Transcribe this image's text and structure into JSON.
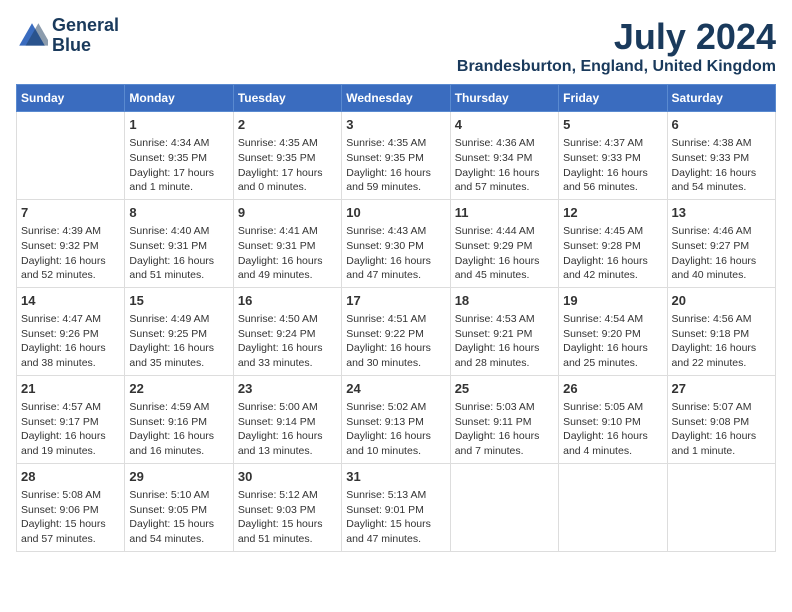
{
  "header": {
    "logo_line1": "General",
    "logo_line2": "Blue",
    "month_year": "July 2024",
    "location": "Brandesburton, England, United Kingdom"
  },
  "days_of_week": [
    "Sunday",
    "Monday",
    "Tuesday",
    "Wednesday",
    "Thursday",
    "Friday",
    "Saturday"
  ],
  "weeks": [
    [
      {
        "day": "",
        "content": ""
      },
      {
        "day": "1",
        "content": "Sunrise: 4:34 AM\nSunset: 9:35 PM\nDaylight: 17 hours\nand 1 minute."
      },
      {
        "day": "2",
        "content": "Sunrise: 4:35 AM\nSunset: 9:35 PM\nDaylight: 17 hours\nand 0 minutes."
      },
      {
        "day": "3",
        "content": "Sunrise: 4:35 AM\nSunset: 9:35 PM\nDaylight: 16 hours\nand 59 minutes."
      },
      {
        "day": "4",
        "content": "Sunrise: 4:36 AM\nSunset: 9:34 PM\nDaylight: 16 hours\nand 57 minutes."
      },
      {
        "day": "5",
        "content": "Sunrise: 4:37 AM\nSunset: 9:33 PM\nDaylight: 16 hours\nand 56 minutes."
      },
      {
        "day": "6",
        "content": "Sunrise: 4:38 AM\nSunset: 9:33 PM\nDaylight: 16 hours\nand 54 minutes."
      }
    ],
    [
      {
        "day": "7",
        "content": "Sunrise: 4:39 AM\nSunset: 9:32 PM\nDaylight: 16 hours\nand 52 minutes."
      },
      {
        "day": "8",
        "content": "Sunrise: 4:40 AM\nSunset: 9:31 PM\nDaylight: 16 hours\nand 51 minutes."
      },
      {
        "day": "9",
        "content": "Sunrise: 4:41 AM\nSunset: 9:31 PM\nDaylight: 16 hours\nand 49 minutes."
      },
      {
        "day": "10",
        "content": "Sunrise: 4:43 AM\nSunset: 9:30 PM\nDaylight: 16 hours\nand 47 minutes."
      },
      {
        "day": "11",
        "content": "Sunrise: 4:44 AM\nSunset: 9:29 PM\nDaylight: 16 hours\nand 45 minutes."
      },
      {
        "day": "12",
        "content": "Sunrise: 4:45 AM\nSunset: 9:28 PM\nDaylight: 16 hours\nand 42 minutes."
      },
      {
        "day": "13",
        "content": "Sunrise: 4:46 AM\nSunset: 9:27 PM\nDaylight: 16 hours\nand 40 minutes."
      }
    ],
    [
      {
        "day": "14",
        "content": "Sunrise: 4:47 AM\nSunset: 9:26 PM\nDaylight: 16 hours\nand 38 minutes."
      },
      {
        "day": "15",
        "content": "Sunrise: 4:49 AM\nSunset: 9:25 PM\nDaylight: 16 hours\nand 35 minutes."
      },
      {
        "day": "16",
        "content": "Sunrise: 4:50 AM\nSunset: 9:24 PM\nDaylight: 16 hours\nand 33 minutes."
      },
      {
        "day": "17",
        "content": "Sunrise: 4:51 AM\nSunset: 9:22 PM\nDaylight: 16 hours\nand 30 minutes."
      },
      {
        "day": "18",
        "content": "Sunrise: 4:53 AM\nSunset: 9:21 PM\nDaylight: 16 hours\nand 28 minutes."
      },
      {
        "day": "19",
        "content": "Sunrise: 4:54 AM\nSunset: 9:20 PM\nDaylight: 16 hours\nand 25 minutes."
      },
      {
        "day": "20",
        "content": "Sunrise: 4:56 AM\nSunset: 9:18 PM\nDaylight: 16 hours\nand 22 minutes."
      }
    ],
    [
      {
        "day": "21",
        "content": "Sunrise: 4:57 AM\nSunset: 9:17 PM\nDaylight: 16 hours\nand 19 minutes."
      },
      {
        "day": "22",
        "content": "Sunrise: 4:59 AM\nSunset: 9:16 PM\nDaylight: 16 hours\nand 16 minutes."
      },
      {
        "day": "23",
        "content": "Sunrise: 5:00 AM\nSunset: 9:14 PM\nDaylight: 16 hours\nand 13 minutes."
      },
      {
        "day": "24",
        "content": "Sunrise: 5:02 AM\nSunset: 9:13 PM\nDaylight: 16 hours\nand 10 minutes."
      },
      {
        "day": "25",
        "content": "Sunrise: 5:03 AM\nSunset: 9:11 PM\nDaylight: 16 hours\nand 7 minutes."
      },
      {
        "day": "26",
        "content": "Sunrise: 5:05 AM\nSunset: 9:10 PM\nDaylight: 16 hours\nand 4 minutes."
      },
      {
        "day": "27",
        "content": "Sunrise: 5:07 AM\nSunset: 9:08 PM\nDaylight: 16 hours\nand 1 minute."
      }
    ],
    [
      {
        "day": "28",
        "content": "Sunrise: 5:08 AM\nSunset: 9:06 PM\nDaylight: 15 hours\nand 57 minutes."
      },
      {
        "day": "29",
        "content": "Sunrise: 5:10 AM\nSunset: 9:05 PM\nDaylight: 15 hours\nand 54 minutes."
      },
      {
        "day": "30",
        "content": "Sunrise: 5:12 AM\nSunset: 9:03 PM\nDaylight: 15 hours\nand 51 minutes."
      },
      {
        "day": "31",
        "content": "Sunrise: 5:13 AM\nSunset: 9:01 PM\nDaylight: 15 hours\nand 47 minutes."
      },
      {
        "day": "",
        "content": ""
      },
      {
        "day": "",
        "content": ""
      },
      {
        "day": "",
        "content": ""
      }
    ]
  ]
}
